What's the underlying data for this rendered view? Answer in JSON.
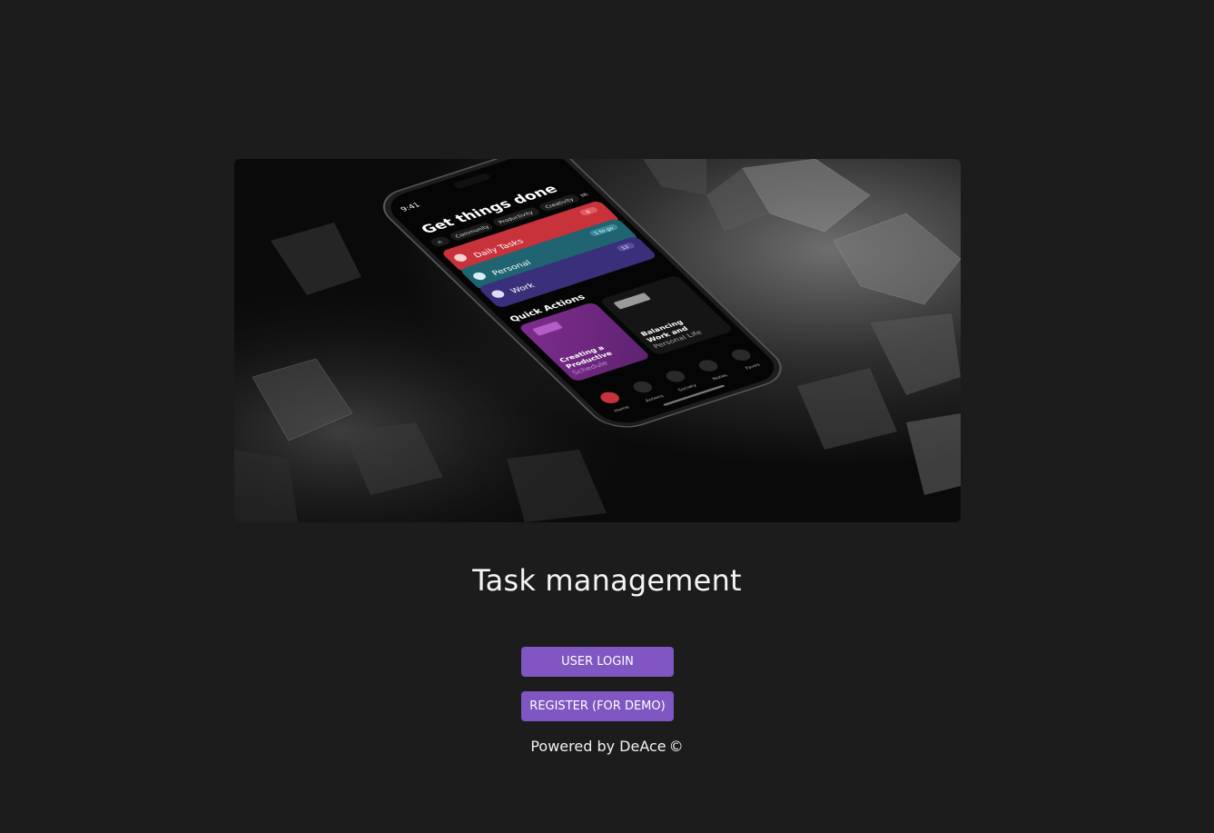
{
  "hero": {
    "status_time": "9:41",
    "heading": "Get things done",
    "chips": [
      "n",
      "Community",
      "Productivity",
      "Creativity",
      "Mi"
    ],
    "lists": [
      {
        "label": "Daily Tasks",
        "badge": "6",
        "color": "#c8323b"
      },
      {
        "label": "Personal",
        "badge": "1 to go",
        "color": "#1f6470"
      },
      {
        "label": "Work",
        "badge": "12",
        "color": "#3a2f7a"
      }
    ],
    "quick_actions_label": "Quick Actions",
    "card_purple": [
      "Creating a",
      "Productive",
      "Schedule"
    ],
    "card_dark": [
      "Balancing",
      "Work and",
      "Personal Life"
    ],
    "tabs": [
      "Home",
      "Actions",
      "Society",
      "Notes",
      "Faves"
    ]
  },
  "page": {
    "title": "Task management"
  },
  "buttons": {
    "login_label": "USER LOGIN",
    "register_label": "REGISTER (FOR DEMO)"
  },
  "footer": {
    "powered_by": "Powered by DeAce",
    "copyright_symbol": "©"
  },
  "colors": {
    "background": "#1c1c1c",
    "accent": "#7f56c2"
  }
}
